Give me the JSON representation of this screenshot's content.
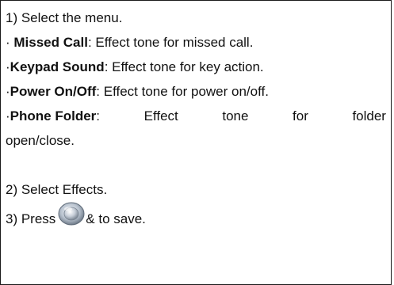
{
  "steps": {
    "step1": "1) Select the menu.",
    "items": [
      {
        "bullet": "· ",
        "term": "Missed Call",
        "desc": ": Effect tone for missed call."
      },
      {
        "bullet": "·",
        "term": "Keypad Sound",
        "desc": ": Effect tone for key action."
      },
      {
        "bullet": "·",
        "term": "Power On/Off",
        "desc": ": Effect tone for power on/off."
      }
    ],
    "phone_folder": {
      "bullet": "·",
      "term": "Phone Folder",
      "colon": ":",
      "words": [
        "Effect",
        "tone",
        "for",
        "folder"
      ],
      "continuation": "open/close."
    },
    "step2": "2) Select Effects.",
    "step3_prefix": "3) Press",
    "step3_suffix": "& to save."
  },
  "icons": {
    "ok_button": "ok-button-icon"
  }
}
